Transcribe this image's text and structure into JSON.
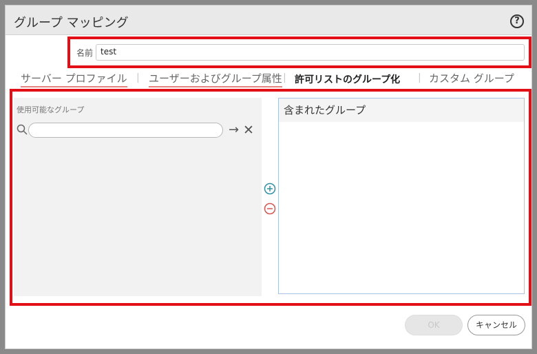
{
  "dialog": {
    "title": "グループ マッピング",
    "help_icon": "question-circle-icon"
  },
  "name_field": {
    "label": "名前",
    "value": "test"
  },
  "tabs": [
    {
      "label": "サーバー プロファイル"
    },
    {
      "label": "ユーザーおよびグループ属性"
    },
    {
      "label": "許可リストのグループ化",
      "active": true
    },
    {
      "label": "カスタム グループ"
    }
  ],
  "left_panel": {
    "header": "使用可能なグループ",
    "search_value": "",
    "icons": [
      "search-icon",
      "arrow-right-icon",
      "close-icon"
    ]
  },
  "middle_icons": [
    "add-circle-icon",
    "remove-circle-icon"
  ],
  "right_panel": {
    "header": "含まれたグループ"
  },
  "footer": {
    "ok_label": "OK",
    "cancel_label": "キャンセル"
  },
  "colors": {
    "highlight_frame": "#e20f17",
    "add_icon": "#2f8fa3",
    "remove_icon": "#d9534f"
  }
}
